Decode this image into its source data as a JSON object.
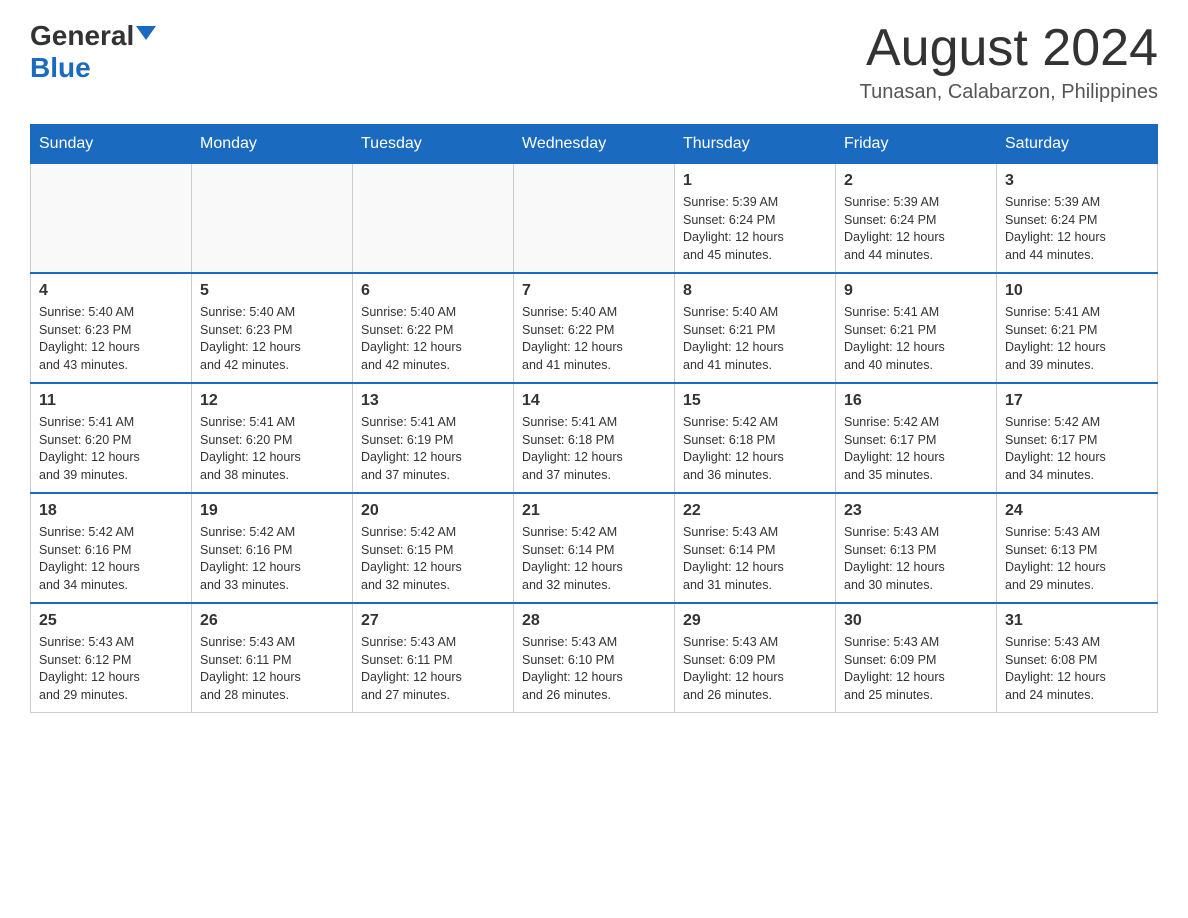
{
  "header": {
    "logo_general": "General",
    "logo_blue": "Blue",
    "month_year": "August 2024",
    "location": "Tunasan, Calabarzon, Philippines"
  },
  "days_of_week": [
    "Sunday",
    "Monday",
    "Tuesday",
    "Wednesday",
    "Thursday",
    "Friday",
    "Saturday"
  ],
  "weeks": [
    {
      "days": [
        {
          "num": "",
          "info": ""
        },
        {
          "num": "",
          "info": ""
        },
        {
          "num": "",
          "info": ""
        },
        {
          "num": "",
          "info": ""
        },
        {
          "num": "1",
          "info": "Sunrise: 5:39 AM\nSunset: 6:24 PM\nDaylight: 12 hours\nand 45 minutes."
        },
        {
          "num": "2",
          "info": "Sunrise: 5:39 AM\nSunset: 6:24 PM\nDaylight: 12 hours\nand 44 minutes."
        },
        {
          "num": "3",
          "info": "Sunrise: 5:39 AM\nSunset: 6:24 PM\nDaylight: 12 hours\nand 44 minutes."
        }
      ]
    },
    {
      "days": [
        {
          "num": "4",
          "info": "Sunrise: 5:40 AM\nSunset: 6:23 PM\nDaylight: 12 hours\nand 43 minutes."
        },
        {
          "num": "5",
          "info": "Sunrise: 5:40 AM\nSunset: 6:23 PM\nDaylight: 12 hours\nand 42 minutes."
        },
        {
          "num": "6",
          "info": "Sunrise: 5:40 AM\nSunset: 6:22 PM\nDaylight: 12 hours\nand 42 minutes."
        },
        {
          "num": "7",
          "info": "Sunrise: 5:40 AM\nSunset: 6:22 PM\nDaylight: 12 hours\nand 41 minutes."
        },
        {
          "num": "8",
          "info": "Sunrise: 5:40 AM\nSunset: 6:21 PM\nDaylight: 12 hours\nand 41 minutes."
        },
        {
          "num": "9",
          "info": "Sunrise: 5:41 AM\nSunset: 6:21 PM\nDaylight: 12 hours\nand 40 minutes."
        },
        {
          "num": "10",
          "info": "Sunrise: 5:41 AM\nSunset: 6:21 PM\nDaylight: 12 hours\nand 39 minutes."
        }
      ]
    },
    {
      "days": [
        {
          "num": "11",
          "info": "Sunrise: 5:41 AM\nSunset: 6:20 PM\nDaylight: 12 hours\nand 39 minutes."
        },
        {
          "num": "12",
          "info": "Sunrise: 5:41 AM\nSunset: 6:20 PM\nDaylight: 12 hours\nand 38 minutes."
        },
        {
          "num": "13",
          "info": "Sunrise: 5:41 AM\nSunset: 6:19 PM\nDaylight: 12 hours\nand 37 minutes."
        },
        {
          "num": "14",
          "info": "Sunrise: 5:41 AM\nSunset: 6:18 PM\nDaylight: 12 hours\nand 37 minutes."
        },
        {
          "num": "15",
          "info": "Sunrise: 5:42 AM\nSunset: 6:18 PM\nDaylight: 12 hours\nand 36 minutes."
        },
        {
          "num": "16",
          "info": "Sunrise: 5:42 AM\nSunset: 6:17 PM\nDaylight: 12 hours\nand 35 minutes."
        },
        {
          "num": "17",
          "info": "Sunrise: 5:42 AM\nSunset: 6:17 PM\nDaylight: 12 hours\nand 34 minutes."
        }
      ]
    },
    {
      "days": [
        {
          "num": "18",
          "info": "Sunrise: 5:42 AM\nSunset: 6:16 PM\nDaylight: 12 hours\nand 34 minutes."
        },
        {
          "num": "19",
          "info": "Sunrise: 5:42 AM\nSunset: 6:16 PM\nDaylight: 12 hours\nand 33 minutes."
        },
        {
          "num": "20",
          "info": "Sunrise: 5:42 AM\nSunset: 6:15 PM\nDaylight: 12 hours\nand 32 minutes."
        },
        {
          "num": "21",
          "info": "Sunrise: 5:42 AM\nSunset: 6:14 PM\nDaylight: 12 hours\nand 32 minutes."
        },
        {
          "num": "22",
          "info": "Sunrise: 5:43 AM\nSunset: 6:14 PM\nDaylight: 12 hours\nand 31 minutes."
        },
        {
          "num": "23",
          "info": "Sunrise: 5:43 AM\nSunset: 6:13 PM\nDaylight: 12 hours\nand 30 minutes."
        },
        {
          "num": "24",
          "info": "Sunrise: 5:43 AM\nSunset: 6:13 PM\nDaylight: 12 hours\nand 29 minutes."
        }
      ]
    },
    {
      "days": [
        {
          "num": "25",
          "info": "Sunrise: 5:43 AM\nSunset: 6:12 PM\nDaylight: 12 hours\nand 29 minutes."
        },
        {
          "num": "26",
          "info": "Sunrise: 5:43 AM\nSunset: 6:11 PM\nDaylight: 12 hours\nand 28 minutes."
        },
        {
          "num": "27",
          "info": "Sunrise: 5:43 AM\nSunset: 6:11 PM\nDaylight: 12 hours\nand 27 minutes."
        },
        {
          "num": "28",
          "info": "Sunrise: 5:43 AM\nSunset: 6:10 PM\nDaylight: 12 hours\nand 26 minutes."
        },
        {
          "num": "29",
          "info": "Sunrise: 5:43 AM\nSunset: 6:09 PM\nDaylight: 12 hours\nand 26 minutes."
        },
        {
          "num": "30",
          "info": "Sunrise: 5:43 AM\nSunset: 6:09 PM\nDaylight: 12 hours\nand 25 minutes."
        },
        {
          "num": "31",
          "info": "Sunrise: 5:43 AM\nSunset: 6:08 PM\nDaylight: 12 hours\nand 24 minutes."
        }
      ]
    }
  ]
}
